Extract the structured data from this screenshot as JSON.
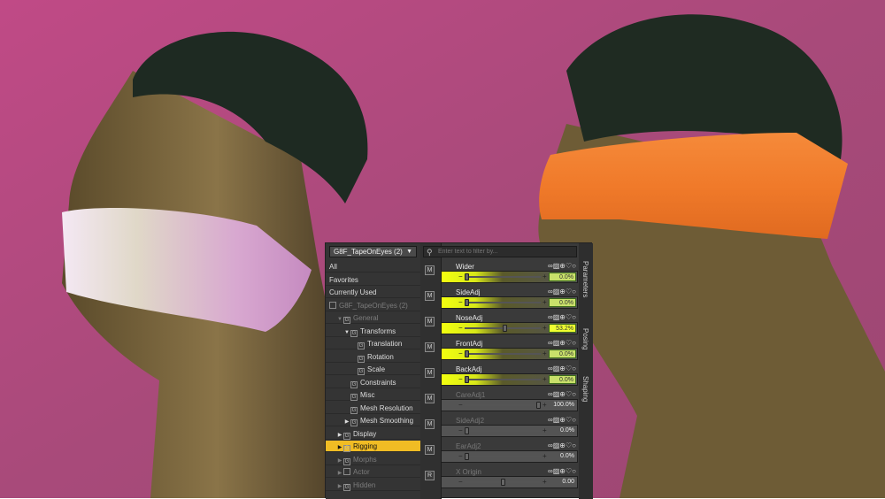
{
  "tree": {
    "figure_select": "G8F_TapeOnEyes (2)",
    "items": [
      {
        "label": "All",
        "indent": 0,
        "expander": "",
        "icon": "",
        "state": "normal"
      },
      {
        "label": "Favorites",
        "indent": 0,
        "expander": "",
        "icon": "",
        "state": "normal"
      },
      {
        "label": "Currently Used",
        "indent": 0,
        "expander": "",
        "icon": "",
        "state": "normal"
      },
      {
        "label": "G8F_TapeOnEyes (2)",
        "indent": 0,
        "expander": "",
        "icon": "figure",
        "state": "dim"
      },
      {
        "label": "General",
        "indent": 1,
        "expander": "open",
        "icon": "group",
        "state": "dim"
      },
      {
        "label": "Transforms",
        "indent": 2,
        "expander": "open",
        "icon": "group",
        "state": "normal"
      },
      {
        "label": "Translation",
        "indent": 3,
        "expander": "",
        "icon": "group",
        "state": "normal"
      },
      {
        "label": "Rotation",
        "indent": 3,
        "expander": "",
        "icon": "group",
        "state": "normal"
      },
      {
        "label": "Scale",
        "indent": 3,
        "expander": "",
        "icon": "group",
        "state": "normal"
      },
      {
        "label": "Constraints",
        "indent": 2,
        "expander": "",
        "icon": "group",
        "state": "normal"
      },
      {
        "label": "Misc",
        "indent": 2,
        "expander": "",
        "icon": "group",
        "state": "normal"
      },
      {
        "label": "Mesh Resolution",
        "indent": 2,
        "expander": "",
        "icon": "group",
        "state": "normal"
      },
      {
        "label": "Mesh Smoothing",
        "indent": 2,
        "expander": "closed",
        "icon": "group",
        "state": "normal"
      },
      {
        "label": "Display",
        "indent": 1,
        "expander": "closed",
        "icon": "group",
        "state": "normal"
      },
      {
        "label": "Rigging",
        "indent": 1,
        "expander": "closed",
        "icon": "group",
        "state": "selected"
      },
      {
        "label": "Morphs",
        "indent": 1,
        "expander": "closed",
        "icon": "group",
        "state": "dim"
      },
      {
        "label": "Actor",
        "indent": 1,
        "expander": "closed",
        "icon": "actor",
        "state": "dim"
      },
      {
        "label": "Hidden",
        "indent": 1,
        "expander": "closed",
        "icon": "group",
        "state": "dim"
      }
    ]
  },
  "search": {
    "placeholder": "Enter text to filter by..."
  },
  "param_icons": "∞▨⊕♡○",
  "params": [
    {
      "label": "Wider",
      "value": "0.0%",
      "fraction": 0.0,
      "state": "active",
      "strip": "M"
    },
    {
      "label": "SideAdj",
      "value": "0.0%",
      "fraction": 0.0,
      "state": "active",
      "strip": "M"
    },
    {
      "label": "NoseAdj",
      "value": "53.2%",
      "fraction": 0.532,
      "state": "active-strong",
      "strip": "M"
    },
    {
      "label": "FrontAdj",
      "value": "0.0%",
      "fraction": 0.0,
      "state": "active",
      "strip": "M"
    },
    {
      "label": "BackAdj",
      "value": "0.0%",
      "fraction": 0.0,
      "state": "active",
      "strip": "M"
    },
    {
      "label": "CareAdj1",
      "value": "100.0%",
      "fraction": 1.0,
      "state": "grey",
      "strip": "M"
    },
    {
      "label": "SideAdj2",
      "value": "0.0%",
      "fraction": 0.0,
      "state": "grey",
      "strip": "M"
    },
    {
      "label": "EarAdj2",
      "value": "0.0%",
      "fraction": 0.0,
      "state": "grey",
      "strip": "M"
    },
    {
      "label": "X Origin",
      "value": "0.00",
      "fraction": 0.5,
      "state": "grey",
      "strip": "R"
    }
  ],
  "tabs": [
    "Parameters",
    "Posing",
    "Shaping"
  ],
  "colors": {
    "highlight": "#f0bc24",
    "active_slider": "#f0ff30",
    "background": "#b8487a",
    "tape_orange": "#f07a2a"
  }
}
